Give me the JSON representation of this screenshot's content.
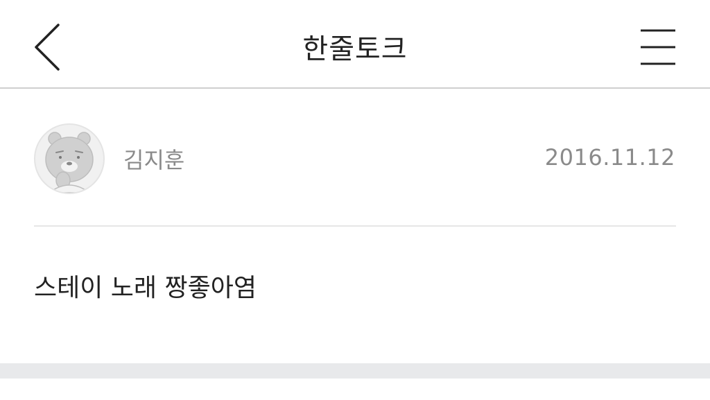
{
  "header": {
    "title": "한줄토크",
    "back_icon": "chevron-left-icon",
    "menu_icon": "hamburger-menu-icon"
  },
  "post": {
    "author": "김지훈",
    "date": "2016.11.12",
    "message": "스테이 노래 짱좋아염",
    "avatar_icon": "bear-character-avatar"
  },
  "colors": {
    "title_text": "#222222",
    "meta_text": "#8a8a8a",
    "divider": "#e6e6e6",
    "band": "#e8e9eb"
  }
}
